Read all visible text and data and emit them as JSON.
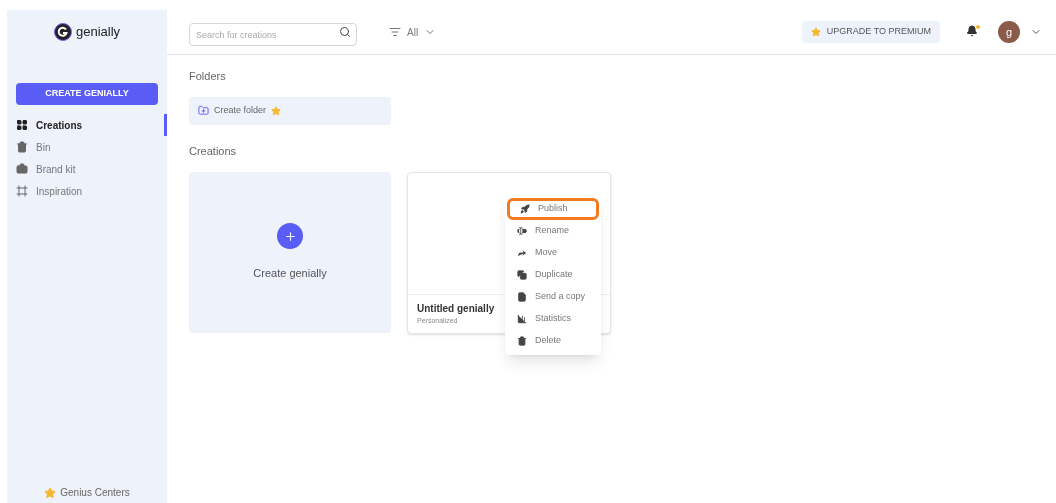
{
  "brand": {
    "name": "genially"
  },
  "search": {
    "placeholder": "Search for creations"
  },
  "filter": {
    "label": "All"
  },
  "upgrade": {
    "label": "UPGRADE TO PREMIUM"
  },
  "notifications": {
    "unread": true
  },
  "avatar": {
    "initial": "g"
  },
  "create_button": "CREATE GENIALLY",
  "nav": [
    {
      "label": "Creations",
      "selected": true
    },
    {
      "label": "Bin",
      "selected": false
    },
    {
      "label": "Brand kit",
      "selected": false
    },
    {
      "label": "Inspiration",
      "selected": false
    }
  ],
  "footer": {
    "label": "Genius Centers"
  },
  "folders": {
    "heading": "Folders",
    "create": "Create folder"
  },
  "creations": {
    "heading": "Creations",
    "new_label": "Create genially",
    "items": [
      {
        "title": "Untitled genially",
        "subtitle": "Personalized"
      }
    ]
  },
  "context_menu": [
    {
      "label": "Publish",
      "selected": true
    },
    {
      "label": "Rename",
      "selected": false
    },
    {
      "label": "Move",
      "selected": false
    },
    {
      "label": "Duplicate",
      "selected": false
    },
    {
      "label": "Send a copy",
      "selected": false
    },
    {
      "label": "Statistics",
      "selected": false
    },
    {
      "label": "Delete",
      "selected": false
    }
  ]
}
